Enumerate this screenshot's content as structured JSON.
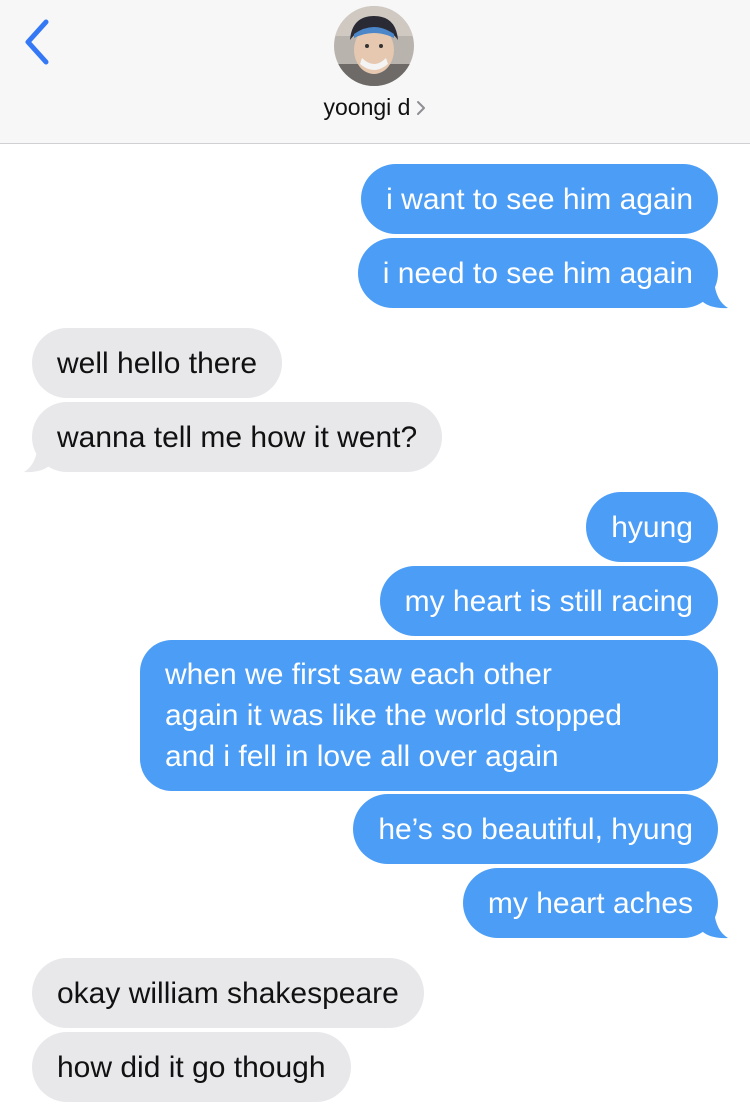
{
  "header": {
    "contact_name": "yoongi d",
    "back_icon": "chevron-left-icon",
    "detail_icon": "chevron-right-icon",
    "accent_color": "#3478f6"
  },
  "colors": {
    "sent_bubble": "#4c9df6",
    "received_bubble": "#e8e8eb"
  },
  "messages": [
    {
      "from": "me",
      "text": "i want to see him again"
    },
    {
      "from": "me",
      "text": "i need to see him again"
    },
    {
      "from": "them",
      "text": "well hello there"
    },
    {
      "from": "them",
      "text": "wanna tell me how it went?"
    },
    {
      "from": "me",
      "text": "hyung"
    },
    {
      "from": "me",
      "text": "my heart is still racing"
    },
    {
      "from": "me",
      "lines": [
        "when we first saw each other",
        "again it was like the world stopped",
        "and i fell in love all over again"
      ]
    },
    {
      "from": "me",
      "text": "he’s so beautiful, hyung"
    },
    {
      "from": "me",
      "text": "my heart aches"
    },
    {
      "from": "them",
      "text": "okay william shakespeare"
    },
    {
      "from": "them",
      "text": "how did it go though"
    }
  ]
}
